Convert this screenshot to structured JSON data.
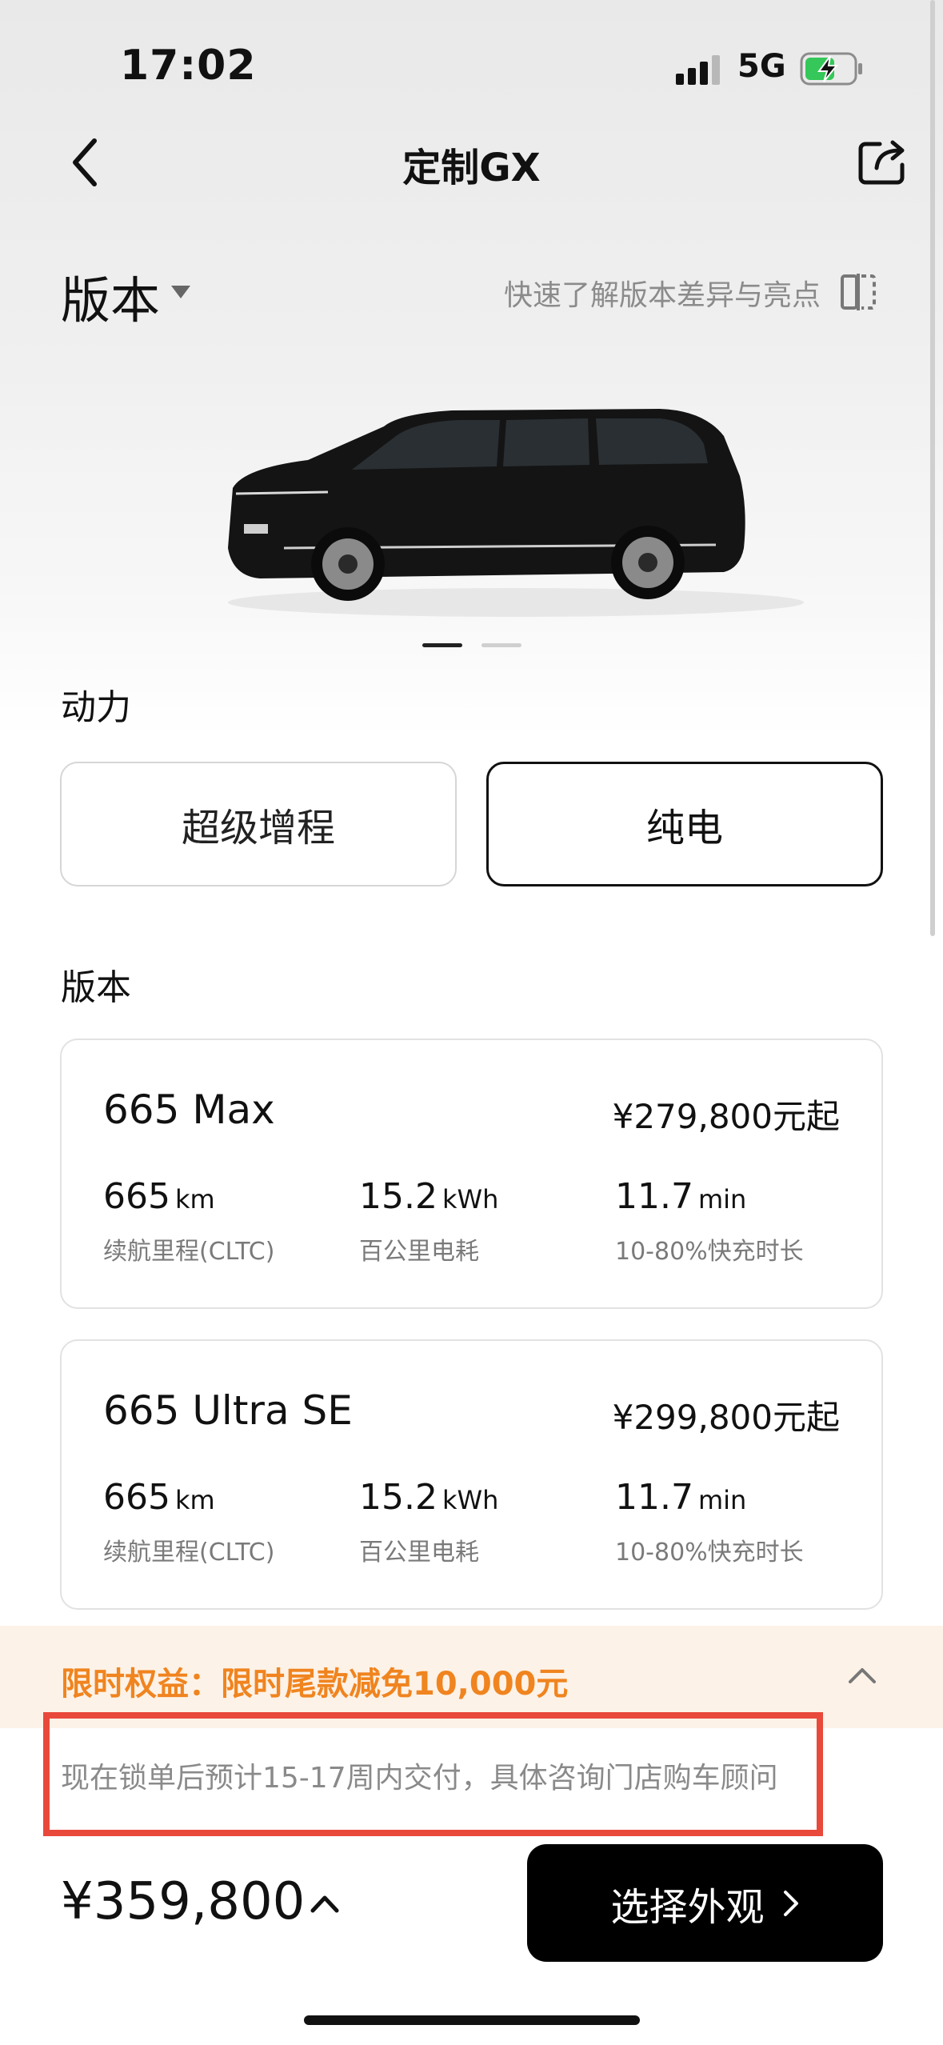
{
  "status_bar": {
    "time": "17:02",
    "network": "5G",
    "icons": [
      "signal-icon",
      "battery-charging-icon"
    ]
  },
  "nav": {
    "title": "定制GX",
    "icons": [
      "back-icon",
      "share-icon"
    ]
  },
  "header": {
    "title": "版本",
    "compare_link": "快速了解版本差异与亮点"
  },
  "carousel": {
    "slide_count": 2,
    "active_index": 0
  },
  "power": {
    "section_title": "动力",
    "options": [
      {
        "label": "超级增程",
        "selected": false
      },
      {
        "label": "纯电",
        "selected": true
      }
    ]
  },
  "versions": {
    "section_title": "版本",
    "items": [
      {
        "name": "665 Max",
        "price": "¥279,800元起",
        "specs": [
          {
            "value": "665",
            "unit": "km",
            "label": "续航里程(CLTC)"
          },
          {
            "value": "15.2",
            "unit": "kWh",
            "label": "百公里电耗"
          },
          {
            "value": "11.7",
            "unit": "min",
            "label": "10-80%快充时长"
          }
        ]
      },
      {
        "name": "665 Ultra SE",
        "price": "¥299,800元起",
        "specs": [
          {
            "value": "665",
            "unit": "km",
            "label": "续航里程(CLTC)"
          },
          {
            "value": "15.2",
            "unit": "kWh",
            "label": "百公里电耗"
          },
          {
            "value": "11.7",
            "unit": "min",
            "label": "10-80%快充时长"
          }
        ]
      }
    ]
  },
  "promo": {
    "text": "限时权益：限时尾款减免10,000元"
  },
  "delivery_note": "现在锁单后预计15-17周内交付，具体咨询门店购车顾问",
  "footer": {
    "total_price": "¥359,800",
    "cta_label": "选择外观"
  },
  "colors": {
    "accent_orange": "#f0841f",
    "promo_bg": "#fdf2e7",
    "highlight_red": "#e9493b",
    "cta_bg": "#000000"
  }
}
